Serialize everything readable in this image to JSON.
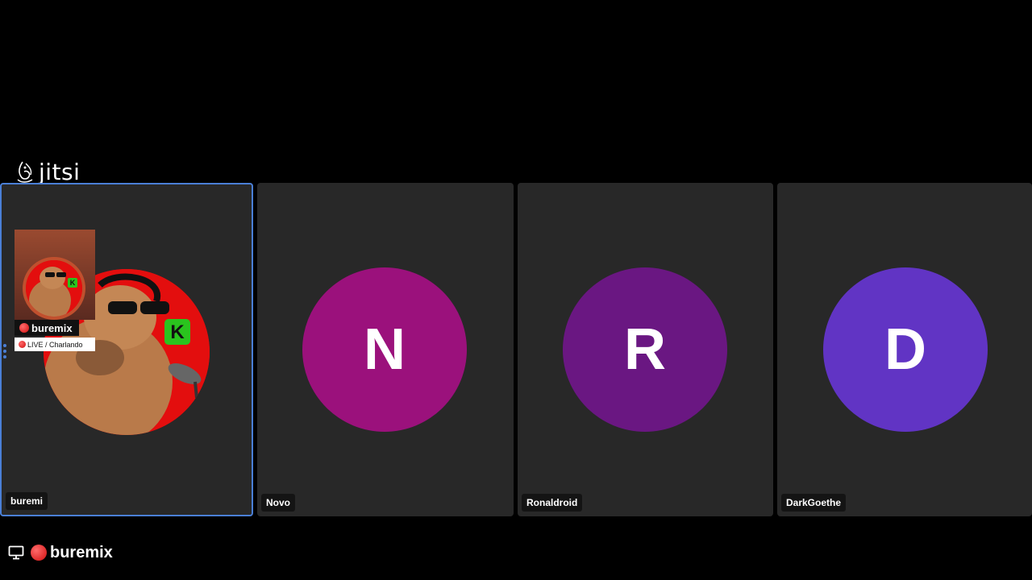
{
  "logo": {
    "wordmark": "jitsi"
  },
  "participants": [
    {
      "name": "buremi",
      "type": "video",
      "active": true
    },
    {
      "name": "Novo",
      "initial": "N",
      "color": "#9b117c"
    },
    {
      "name": "Ronaldroid",
      "initial": "R",
      "color": "#6a1782"
    },
    {
      "name": "DarkGoethe",
      "initial": "D",
      "color": "#6134c4"
    }
  ],
  "pip_overlay": {
    "title": "buremix",
    "subtitle": "LIVE / Charlando"
  },
  "bottom_bar": {
    "icon": "screen-share-icon",
    "label": "buremix"
  },
  "colors": {
    "active_border": "#4a7fd6",
    "tile_background": "#282828",
    "background": "#000000",
    "live_dot": "#e01e1e"
  }
}
